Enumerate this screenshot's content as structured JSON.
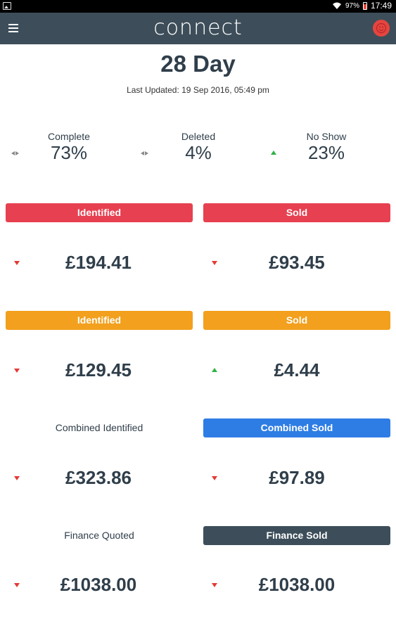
{
  "status_bar": {
    "battery": "97%",
    "time": "17:49",
    "battery_color": "#e74c3c"
  },
  "app_bar": {
    "brand": "connect",
    "background": "#3d4e5a",
    "avatar_color": "#e5453f"
  },
  "header": {
    "title": "28 Day",
    "last_updated": "Last Updated: 19 Sep 2016, 05:49 pm"
  },
  "stats": [
    {
      "label": "Complete",
      "value": "73%",
      "trend": "flat"
    },
    {
      "label": "Deleted",
      "value": "4%",
      "trend": "flat"
    },
    {
      "label": "No Show",
      "value": "23%",
      "trend": "up"
    }
  ],
  "sections": [
    {
      "left": {
        "label": "Identified",
        "style": "red",
        "amount": "£194.41",
        "trend": "down"
      },
      "right": {
        "label": "Sold",
        "style": "red",
        "amount": "£93.45",
        "trend": "down"
      }
    },
    {
      "left": {
        "label": "Identified",
        "style": "orange",
        "amount": "£129.45",
        "trend": "down"
      },
      "right": {
        "label": "Sold",
        "style": "orange",
        "amount": "£4.44",
        "trend": "up"
      }
    },
    {
      "left": {
        "label": "Combined Identified",
        "style": "plain",
        "amount": "£323.86",
        "trend": "down"
      },
      "right": {
        "label": "Combined Sold",
        "style": "blue",
        "amount": "£97.89",
        "trend": "down"
      }
    },
    {
      "left": {
        "label": "Finance Quoted",
        "style": "plain",
        "amount": "£1038.00",
        "trend": "down"
      },
      "right": {
        "label": "Finance Sold",
        "style": "slate",
        "amount": "£1038.00",
        "trend": "down"
      }
    }
  ],
  "colors": {
    "red": "#e74050",
    "orange": "#f2a01d",
    "blue": "#2e7de5",
    "slate": "#3d4e5a",
    "trend_down": "#e53935",
    "trend_up": "#2fb344",
    "trend_flat": "#888888"
  }
}
